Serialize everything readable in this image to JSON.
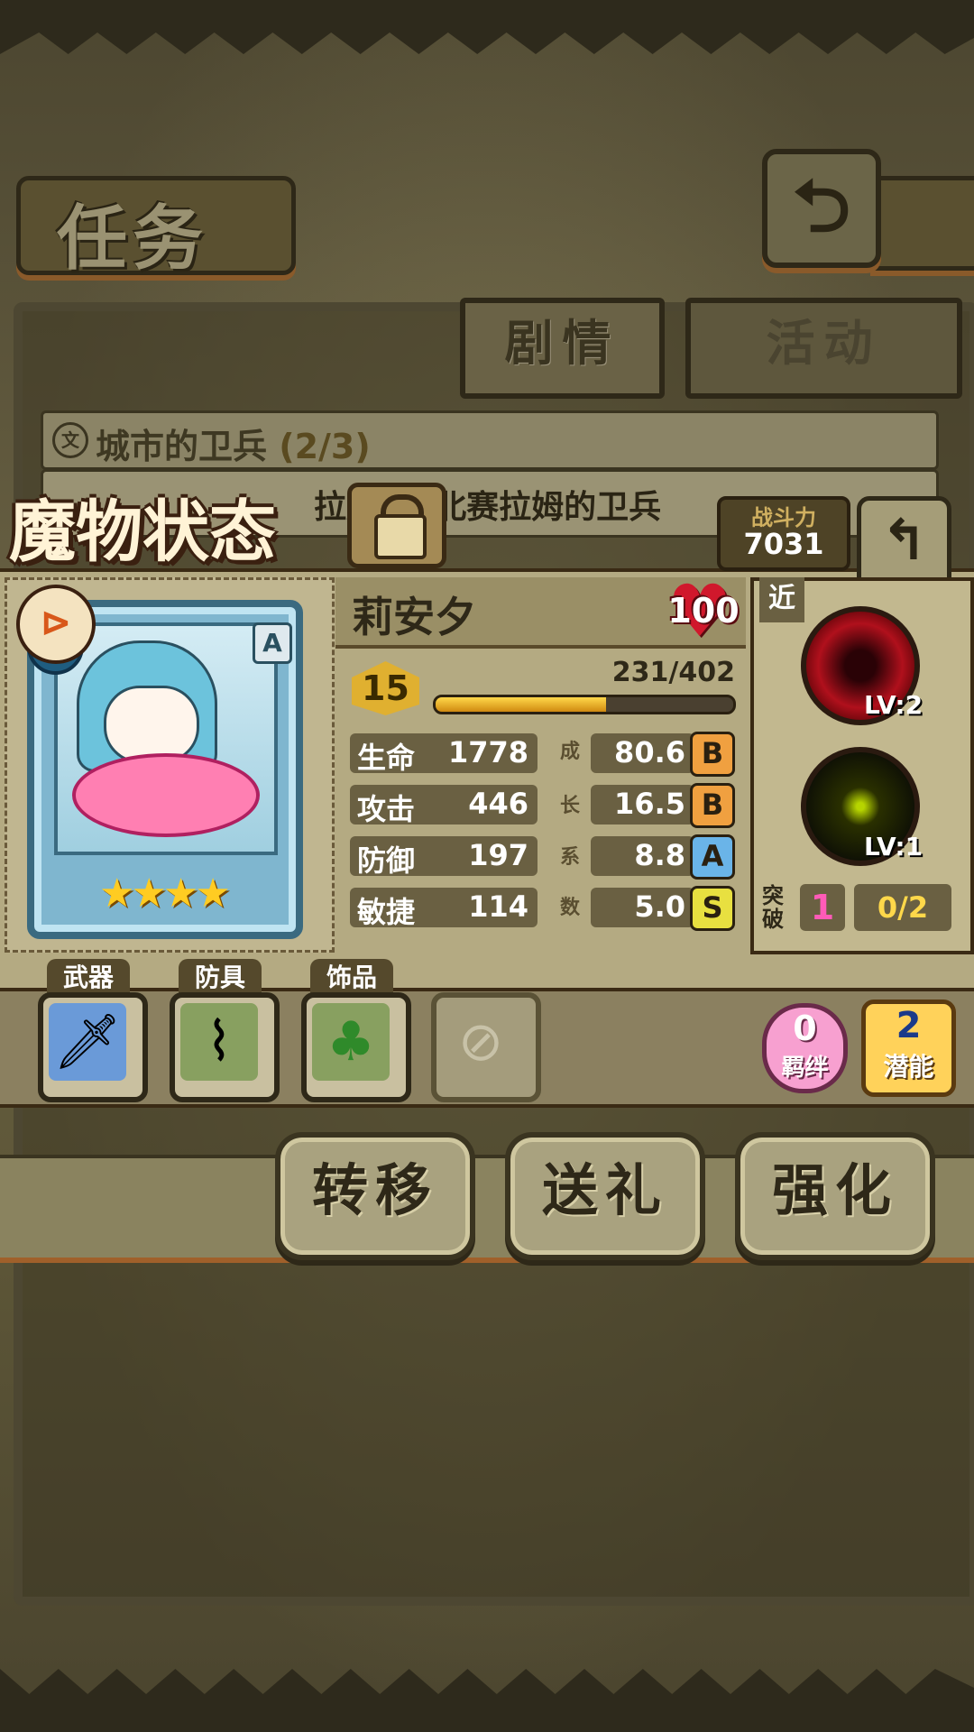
{
  "quest_screen": {
    "title": "任务",
    "tabs": [
      {
        "label": "剧情",
        "active": true
      },
      {
        "label": "活动",
        "active": false
      }
    ],
    "quest_item": {
      "title": "城市的卫兵",
      "progress": "(2/3)",
      "description": "拉姆 给 北赛拉姆的卫兵"
    },
    "action_buttons": [
      "转移",
      "送礼",
      "强化"
    ]
  },
  "monster_panel": {
    "title": "魔物状态",
    "combat_power_label": "战斗力",
    "combat_power": "7031",
    "monster": {
      "name": "莉安夕",
      "level_cap": "100",
      "level": "15",
      "rank": "A",
      "stars": "★★★★",
      "xp_text": "231/402",
      "xp_fraction": 0.574
    },
    "stats": [
      {
        "label": "生命",
        "value": "1778",
        "growth": "80.6",
        "grade": "B"
      },
      {
        "label": "攻击",
        "value": "446",
        "growth": "16.5",
        "grade": "B"
      },
      {
        "label": "防御",
        "value": "197",
        "growth": "8.8",
        "grade": "A"
      },
      {
        "label": "敏捷",
        "value": "114",
        "growth": "5.0",
        "grade": "S"
      }
    ],
    "growth_coef_chars": [
      "成",
      "长",
      "系",
      "数"
    ],
    "skills": {
      "range_tag": "近",
      "items": [
        {
          "icon": "maw-icon",
          "level": "LV:2"
        },
        {
          "icon": "lightning-icon",
          "level": "LV:1"
        }
      ],
      "breakthrough_label": "突破",
      "breakthrough_count": "1",
      "breakthrough_progress": "0/2"
    },
    "equipment": {
      "slots": [
        {
          "label": "武器",
          "icon": "sword-icon"
        },
        {
          "label": "防具",
          "icon": "belt-icon"
        },
        {
          "label": "饰品",
          "icon": "clover-icon"
        },
        {
          "label": "",
          "icon": "empty-slot-icon"
        }
      ],
      "bond": {
        "count": "0",
        "label": "羁绊"
      },
      "potential": {
        "count": "2",
        "label": "潜能"
      }
    }
  },
  "colors": {
    "grade_B": "#f0a040",
    "grade_A": "#6ab4e8",
    "grade_S": "#e8e040"
  }
}
